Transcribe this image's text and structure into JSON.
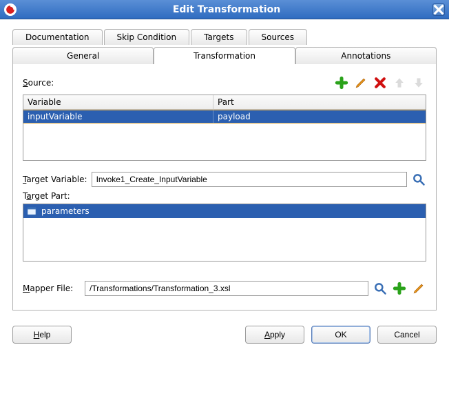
{
  "title": "Edit Transformation",
  "tabs_row1": {
    "documentation": "Documentation",
    "skip_condition": "Skip Condition",
    "targets": "Targets",
    "sources": "Sources"
  },
  "tabs_row2": {
    "general": "General",
    "transformation": "Transformation",
    "annotations": "Annotations"
  },
  "source": {
    "label": "Source:",
    "headers": {
      "variable": "Variable",
      "part": "Part"
    },
    "rows": [
      {
        "variable": "inputVariable",
        "part": "payload"
      }
    ]
  },
  "target_variable": {
    "label": "Target Variable:",
    "value": "Invoke1_Create_InputVariable"
  },
  "target_part": {
    "label": "Target Part:",
    "items": [
      {
        "text": "parameters"
      }
    ]
  },
  "mapper_file": {
    "label": "Mapper File:",
    "value": "/Transformations/Transformation_3.xsl"
  },
  "buttons": {
    "help": "Help",
    "apply": "Apply",
    "ok": "OK",
    "cancel": "Cancel"
  }
}
